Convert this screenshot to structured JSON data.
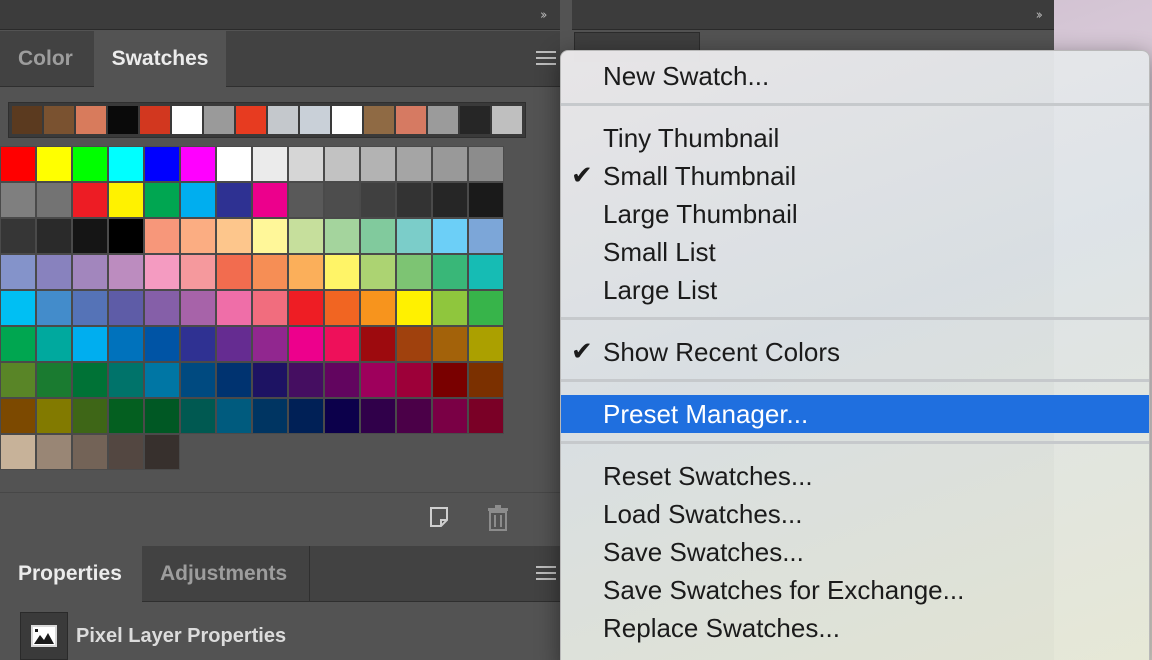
{
  "swatches_panel": {
    "tabs": [
      "Color",
      "Swatches"
    ],
    "active_tab": "Swatches",
    "recent_colors": [
      "#5b3a1f",
      "#7a5230",
      "#d87b5c",
      "#0a0a0a",
      "#d2371f",
      "#ffffff",
      "#9a9a9a",
      "#e73b20",
      "#c4c8cc",
      "#c9d0d8",
      "#ffffff",
      "#8f6a44",
      "#d67a62",
      "#9b9b9b",
      "#262626",
      "#bfbfbf"
    ],
    "grid_colors": [
      "#ff0000",
      "#ffff00",
      "#00ff00",
      "#00ffff",
      "#0000ff",
      "#ff00ff",
      "#ffffff",
      "#ebebeb",
      "#d6d6d6",
      "#c2c2c2",
      "#b3b3b3",
      "#a5a5a5",
      "#999999",
      "#8c8c8c",
      "#7f7f7f",
      "#737373",
      "#ed1c24",
      "#fff200",
      "#00a651",
      "#00aeef",
      "#2e3192",
      "#ec008c",
      "#595959",
      "#4d4d4d",
      "#404040",
      "#333333",
      "#262626",
      "#1a1a1a",
      "#363636",
      "#2a2a2a",
      "#151515",
      "#000000",
      "#f7977a",
      "#fbad82",
      "#fdc68c",
      "#fff799",
      "#c6df9c",
      "#a4d49d",
      "#81ca9d",
      "#7bcdc9",
      "#6ccff7",
      "#7ca6d8",
      "#8493ca",
      "#8882be",
      "#a286bd",
      "#bc8cbf",
      "#f49bc1",
      "#f5999d",
      "#f26c4f",
      "#f68e55",
      "#fbaf5a",
      "#fff467",
      "#acd372",
      "#7dc473",
      "#39b778",
      "#16bcb4",
      "#00bff3",
      "#438ccb",
      "#5573b7",
      "#5e5ca7",
      "#855fa8",
      "#a763a9",
      "#ef6ea8",
      "#f16d7e",
      "#ee1d24",
      "#f16522",
      "#f7941d",
      "#fff100",
      "#8fc63d",
      "#37b44a",
      "#00a650",
      "#00a99e",
      "#00aeef",
      "#0072bc",
      "#0054a5",
      "#2f3192",
      "#652c91",
      "#91278f",
      "#ed008c",
      "#ee105a",
      "#9d0a0e",
      "#a0410d",
      "#a3620a",
      "#aba000",
      "#598527",
      "#1a7b30",
      "#007236",
      "#00736a",
      "#0076a4",
      "#004a80",
      "#003370",
      "#1d1363",
      "#450e61",
      "#62055f",
      "#9e005c",
      "#9d0039",
      "#790000",
      "#7b3000",
      "#7c4900",
      "#827a00",
      "#3e6617",
      "#045f20",
      "#005824",
      "#005951",
      "#005b7e",
      "#003562",
      "#002056",
      "#0c004b",
      "#30004a",
      "#4b0048",
      "#7a0045",
      "#7a0026",
      "#c7b299",
      "#998675",
      "#736357",
      "#534741",
      "#37302d"
    ],
    "footer_icons": [
      "new-swatch-icon",
      "trash-icon"
    ]
  },
  "properties_panel": {
    "tabs": [
      "Properties",
      "Adjustments"
    ],
    "active_tab": "Properties",
    "layer_label": "Pixel Layer Properties",
    "layer_icon": "pixel-layer-icon"
  },
  "panel_menu": {
    "groups": [
      [
        {
          "label": "New Swatch...",
          "checked": false
        }
      ],
      [
        {
          "label": "Tiny Thumbnail",
          "checked": false
        },
        {
          "label": "Small Thumbnail",
          "checked": true
        },
        {
          "label": "Large Thumbnail",
          "checked": false
        },
        {
          "label": "Small List",
          "checked": false
        },
        {
          "label": "Large List",
          "checked": false
        }
      ],
      [
        {
          "label": "Show Recent Colors",
          "checked": true
        }
      ],
      [
        {
          "label": "Preset Manager...",
          "checked": false,
          "highlighted": true
        }
      ],
      [
        {
          "label": "Reset Swatches...",
          "checked": false
        },
        {
          "label": "Load Swatches...",
          "checked": false
        },
        {
          "label": "Save Swatches...",
          "checked": false
        },
        {
          "label": "Save Swatches for Exchange...",
          "checked": false
        },
        {
          "label": "Replace Swatches...",
          "checked": false
        }
      ]
    ],
    "check_glyph": "✔",
    "highlight_color": "#1f6fdf"
  }
}
